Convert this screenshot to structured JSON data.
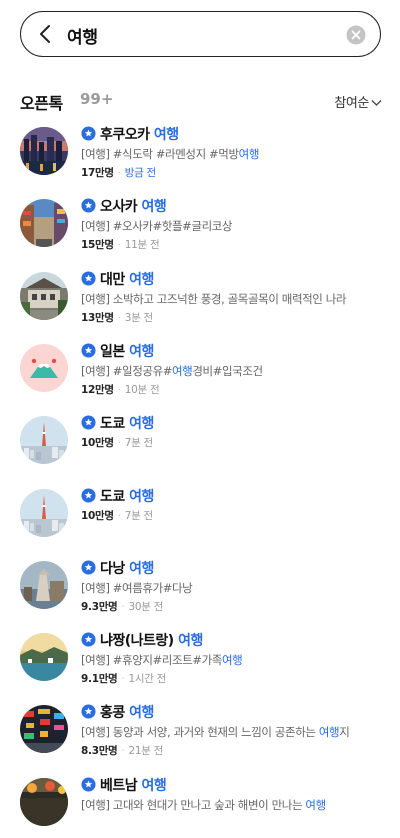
{
  "search": {
    "query": "여행"
  },
  "section": {
    "title": "오픈톡",
    "count": "99+",
    "sort_label": "참여순"
  },
  "results": [
    {
      "title_prefix": "후쿠오카 ",
      "title_highlight": "여행",
      "desc_parts": [
        [
          "[여행] #식도락 #라멘성지 #먹방",
          false
        ],
        [
          "여행",
          true
        ]
      ],
      "members": "17만명",
      "time": "방금 전",
      "time_blue": true,
      "avatar": "city-night"
    },
    {
      "title_prefix": "오사카 ",
      "title_highlight": "여행",
      "desc_parts": [
        [
          "[여행] #오사카#핫플#글리코상",
          false
        ]
      ],
      "members": "15만명",
      "time": "11분 전",
      "time_blue": false,
      "avatar": "street"
    },
    {
      "title_prefix": "대만 ",
      "title_highlight": "여행",
      "desc_parts": [
        [
          "[여행] 소박하고 고즈넉한 풍경, 골목골목이 매력적인 나라",
          false
        ]
      ],
      "members": "13만명",
      "time": "3분 전",
      "time_blue": false,
      "avatar": "old-town"
    },
    {
      "title_prefix": "일본 ",
      "title_highlight": "여행",
      "desc_parts": [
        [
          "[여행] #일정공유#",
          false
        ],
        [
          "여행",
          true
        ],
        [
          "경비#입국조건",
          false
        ]
      ],
      "members": "12만명",
      "time": "10분 전",
      "time_blue": false,
      "avatar": "fuji"
    },
    {
      "title_prefix": "도쿄 ",
      "title_highlight": "여행",
      "desc_parts": [],
      "members": "10만명",
      "time": "7분 전",
      "time_blue": false,
      "avatar": "tower"
    },
    {
      "title_prefix": "도쿄 ",
      "title_highlight": "여행",
      "desc_parts": [],
      "members": "10만명",
      "time": "7분 전",
      "time_blue": false,
      "avatar": "tower"
    },
    {
      "title_prefix": "다낭 ",
      "title_highlight": "여행",
      "desc_parts": [
        [
          "[여행] #여름휴가#다낭",
          false
        ]
      ],
      "members": "9.3만명",
      "time": "30분 전",
      "time_blue": false,
      "avatar": "statue"
    },
    {
      "title_prefix": "냐짱(나트랑) ",
      "title_highlight": "여행",
      "desc_parts": [
        [
          "[여행] #휴양지#리조트#가족",
          false
        ],
        [
          "여행",
          true
        ]
      ],
      "members": "9.1만명",
      "time": "1시간 전",
      "time_blue": false,
      "avatar": "bay"
    },
    {
      "title_prefix": "홍콩 ",
      "title_highlight": "여행",
      "desc_parts": [
        [
          "[여행] 동양과 서양, 과거와 현재의 느낌이 공존하는 ",
          false
        ],
        [
          "여행",
          true
        ],
        [
          "지",
          false
        ]
      ],
      "members": "8.3만명",
      "time": "21분 전",
      "time_blue": false,
      "avatar": "neon"
    },
    {
      "title_prefix": "베트남 ",
      "title_highlight": "여행",
      "desc_parts": [
        [
          "[여행] 고대와 현대가 만나고 숲과 해변이 만나는 ",
          false
        ],
        [
          "여행",
          true
        ]
      ],
      "members": "",
      "time": "",
      "time_blue": false,
      "avatar": "market"
    }
  ]
}
